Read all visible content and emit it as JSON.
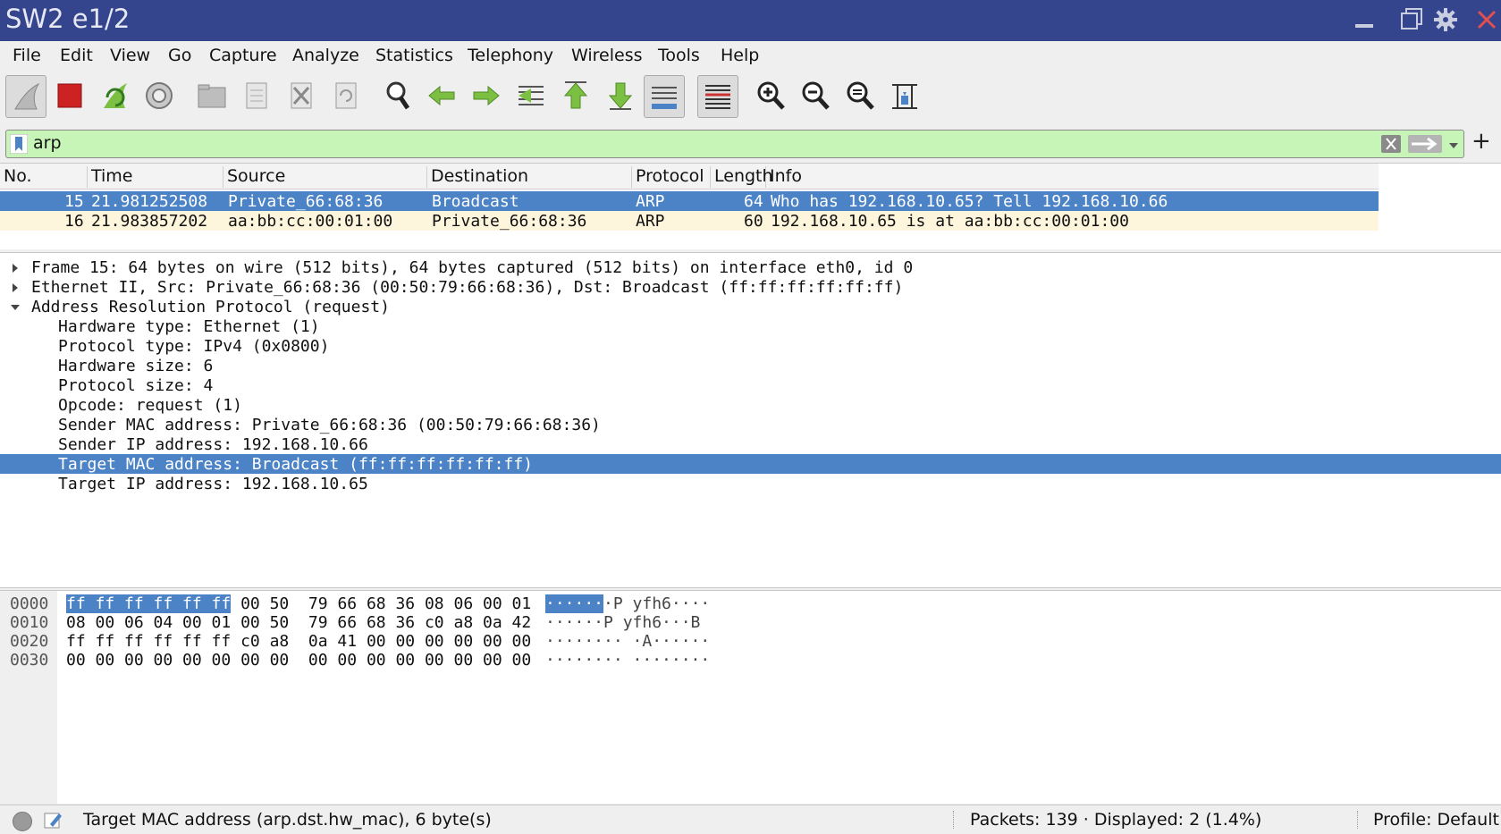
{
  "window": {
    "title": "SW2 e1/2"
  },
  "menu": [
    "File",
    "Edit",
    "View",
    "Go",
    "Capture",
    "Analyze",
    "Statistics",
    "Telephony",
    "Wireless",
    "Tools",
    "Help"
  ],
  "toolbar": {
    "icons": [
      "shark-fin-start-icon",
      "stop-capture-icon",
      "restart-capture-icon",
      "capture-options-icon",
      "open-file-icon",
      "save-file-icon",
      "close-file-icon",
      "reload-file-icon",
      "find-packet-icon",
      "go-back-icon",
      "go-forward-icon",
      "go-to-packet-icon",
      "first-packet-icon",
      "last-packet-icon",
      "autoscroll-icon",
      "colorize-icon",
      "zoom-in-icon",
      "zoom-out-icon",
      "normal-size-icon",
      "resize-columns-icon"
    ]
  },
  "filter": {
    "value": "arp",
    "add_label": "+"
  },
  "packet_list": {
    "columns": [
      "No.",
      "Time",
      "Source",
      "Destination",
      "Protocol",
      "Length",
      "Info"
    ],
    "rows": [
      {
        "no": "15",
        "time": "21.981252508",
        "source": "Private_66:68:36",
        "destination": "Broadcast",
        "protocol": "ARP",
        "length": "64",
        "info": "Who has 192.168.10.65? Tell 192.168.10.66",
        "selected": true
      },
      {
        "no": "16",
        "time": "21.983857202",
        "source": "aa:bb:cc:00:01:00",
        "destination": "Private_66:68:36",
        "protocol": "ARP",
        "length": "60",
        "info": "192.168.10.65 is at aa:bb:cc:00:01:00",
        "selected": false
      }
    ]
  },
  "details": {
    "rows": [
      {
        "text": "Frame 15: 64 bytes on wire (512 bits), 64 bytes captured (512 bits) on interface eth0, id 0",
        "level": 0,
        "expander": "collapsed"
      },
      {
        "text": "Ethernet II, Src: Private_66:68:36 (00:50:79:66:68:36), Dst: Broadcast (ff:ff:ff:ff:ff:ff)",
        "level": 0,
        "expander": "collapsed"
      },
      {
        "text": "Address Resolution Protocol (request)",
        "level": 0,
        "expander": "expanded"
      },
      {
        "text": "Hardware type: Ethernet (1)",
        "level": 1
      },
      {
        "text": "Protocol type: IPv4 (0x0800)",
        "level": 1
      },
      {
        "text": "Hardware size: 6",
        "level": 1
      },
      {
        "text": "Protocol size: 4",
        "level": 1
      },
      {
        "text": "Opcode: request (1)",
        "level": 1
      },
      {
        "text": "Sender MAC address: Private_66:68:36 (00:50:79:66:68:36)",
        "level": 1
      },
      {
        "text": "Sender IP address: 192.168.10.66",
        "level": 1
      },
      {
        "text": "Target MAC address: Broadcast (ff:ff:ff:ff:ff:ff)",
        "level": 1,
        "selected": true
      },
      {
        "text": "Target IP address: 192.168.10.65",
        "level": 1
      }
    ]
  },
  "bytes": {
    "rows": [
      {
        "offset": "0000",
        "hex_sel": "ff ff ff ff ff ff",
        "hex_rest": " 00 50  79 66 68 36 08 06 00 01",
        "ascii_sel": "······",
        "ascii_rest": "·P yfh6····"
      },
      {
        "offset": "0010",
        "hex_sel": "",
        "hex_rest": "08 00 06 04 00 01 00 50  79 66 68 36 c0 a8 0a 42",
        "ascii_sel": "",
        "ascii_rest": "······P yfh6···B"
      },
      {
        "offset": "0020",
        "hex_sel": "",
        "hex_rest": "ff ff ff ff ff ff c0 a8  0a 41 00 00 00 00 00 00",
        "ascii_sel": "",
        "ascii_rest": "········ ·A······"
      },
      {
        "offset": "0030",
        "hex_sel": "",
        "hex_rest": "00 00 00 00 00 00 00 00  00 00 00 00 00 00 00 00",
        "ascii_sel": "",
        "ascii_rest": "········ ········"
      }
    ]
  },
  "status": {
    "field": "Target MAC address (arp.dst.hw_mac), 6 byte(s)",
    "packets": "Packets: 139 · Displayed: 2 (1.4%)",
    "profile": "Profile: Default"
  },
  "colors": {
    "titlebar": "#34458e",
    "selection": "#4c83c7",
    "filter_valid": "#c7f5b7",
    "row_alt": "#fdf5dc",
    "stop_red": "#cc2222",
    "arrow_green": "#7cc043"
  }
}
